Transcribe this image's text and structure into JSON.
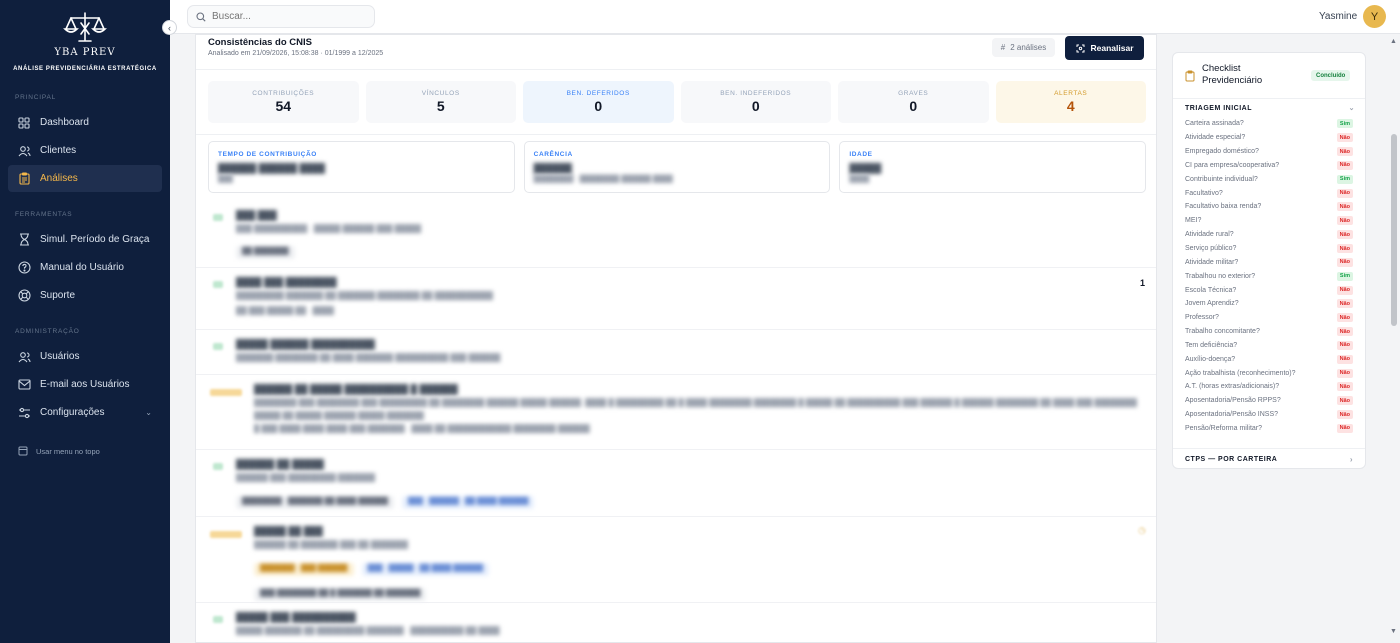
{
  "brand": {
    "name": "YBA PREV",
    "tagline": "ANÁLISE PREVIDENCIÁRIA ESTRATÉGICA"
  },
  "sidebar": {
    "sections": [
      {
        "label": "PRINCIPAL",
        "items": [
          {
            "label": "Dashboard",
            "icon": "grid-icon"
          },
          {
            "label": "Clientes",
            "icon": "users-icon"
          },
          {
            "label": "Análises",
            "icon": "clipboard-icon",
            "active": true
          }
        ]
      },
      {
        "label": "FERRAMENTAS",
        "items": [
          {
            "label": "Simul. Período de Graça",
            "icon": "hourglass-icon"
          },
          {
            "label": "Manual do Usuário",
            "icon": "help-circle-icon"
          },
          {
            "label": "Suporte",
            "icon": "lifebuoy-icon"
          }
        ]
      },
      {
        "label": "ADMINISTRAÇÃO",
        "items": [
          {
            "label": "Usuários",
            "icon": "users-icon"
          },
          {
            "label": "E-mail aos Usuários",
            "icon": "mail-icon"
          },
          {
            "label": "Configurações",
            "icon": "settings-icon"
          }
        ]
      }
    ],
    "top_menu_toggle": "Usar menu no topo",
    "colors": {
      "bg": "#0f1f3d",
      "active_text": "#f6b84a"
    }
  },
  "topbar": {
    "search_placeholder": "Buscar...",
    "user_name": "Yasmine",
    "avatar_initial": "Y"
  },
  "main": {
    "title": "Consistências do CNIS",
    "subtitle": "Analisado em 21/09/2026, 15:08:38 · 01/1999 a 12/2025",
    "analyses_count": "2 análises",
    "reanalyze_label": "Reanalisar",
    "stats": [
      {
        "label": "CONTRIBUIÇÕES",
        "value": "54",
        "tone": "plain"
      },
      {
        "label": "VÍNCULOS",
        "value": "5",
        "tone": "plain"
      },
      {
        "label": "BEN. DEFERIDOS",
        "value": "0",
        "tone": "blue"
      },
      {
        "label": "BEN. INDEFERIDOS",
        "value": "0",
        "tone": "plain"
      },
      {
        "label": "GRAVES",
        "value": "0",
        "tone": "plain"
      },
      {
        "label": "ALERTAS",
        "value": "4",
        "tone": "amber"
      }
    ],
    "info_cards": [
      {
        "label": "TEMPO DE CONTRIBUIÇÃO",
        "value": "",
        "detail": ""
      },
      {
        "label": "CARÊNCIA",
        "value": "",
        "detail": ""
      },
      {
        "label": "IDADE",
        "value": "",
        "detail": ""
      }
    ],
    "first_row_count": "1"
  },
  "checklist": {
    "title": "Checklist Previdenciário",
    "status": "Concluído",
    "section_title": "TRIAGEM INICIAL",
    "items": [
      {
        "q": "Carteira assinada?",
        "a": "Sim"
      },
      {
        "q": "Atividade especial?",
        "a": "Não"
      },
      {
        "q": "Empregado doméstico?",
        "a": "Não"
      },
      {
        "q": "CI para empresa/cooperativa?",
        "a": "Não"
      },
      {
        "q": "Contribuinte individual?",
        "a": "Sim"
      },
      {
        "q": "Facultativo?",
        "a": "Não"
      },
      {
        "q": "Facultativo baixa renda?",
        "a": "Não"
      },
      {
        "q": "MEI?",
        "a": "Não"
      },
      {
        "q": "Atividade rural?",
        "a": "Não"
      },
      {
        "q": "Serviço público?",
        "a": "Não"
      },
      {
        "q": "Atividade militar?",
        "a": "Não"
      },
      {
        "q": "Trabalhou no exterior?",
        "a": "Sim"
      },
      {
        "q": "Escola Técnica?",
        "a": "Não"
      },
      {
        "q": "Jovem Aprendiz?",
        "a": "Não"
      },
      {
        "q": "Professor?",
        "a": "Não"
      },
      {
        "q": "Trabalho concomitante?",
        "a": "Não"
      },
      {
        "q": "Tem deficiência?",
        "a": "Não"
      },
      {
        "q": "Auxílio-doença?",
        "a": "Não"
      },
      {
        "q": "Ação trabalhista (reconhecimento)?",
        "a": "Não"
      },
      {
        "q": "A.T. (horas extras/adicionais)?",
        "a": "Não"
      },
      {
        "q": "Aposentadoria/Pensão RPPS?",
        "a": "Não"
      },
      {
        "q": "Aposentadoria/Pensão INSS?",
        "a": "Não"
      },
      {
        "q": "Pensão/Reforma militar?",
        "a": "Não"
      }
    ],
    "footer_section": "CTPS — POR CARTEIRA"
  }
}
